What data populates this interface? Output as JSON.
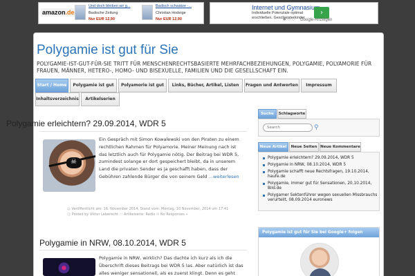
{
  "ads": {
    "amazon": {
      "logo": "amazon",
      "logo_suffix": ".de",
      "items": [
        {
          "title": "Und doch bleiben wir g...",
          "subtitle": "Badische Zeitung",
          "price": "Nur EUR 12,90"
        },
        {
          "title": "Badisch schwätze -...",
          "subtitle": "Christian Hodeige",
          "price": "Nur EUR 12,90"
        }
      ]
    },
    "google": {
      "title": "Internet und Gymnasium",
      "text": "Individuelle Potenziale optimal erschließen. Geschwisterkinder",
      "label": "Google-Anzeigen",
      "arrow": "›"
    }
  },
  "site": {
    "title": "Polygamie ist gut für Sie",
    "description": "POLYGAMIE-IST-GUT-FÜR-SIE TRITT FÜR MENSCHENRECHTSBASIERTE MEHRFACHBEZIEHUNGEN, POLYGAMIE, POLYAMORIE FÜR FRAUEN, MÄNNER, HETERO-, HOMO- UND BISEXUELLE, FAMILIEN UND DIE GESELLSCHAFT EIN."
  },
  "nav": {
    "items": [
      {
        "label": "Start / Home",
        "active": true
      },
      {
        "label": "Polygamie ist gut",
        "active": false
      },
      {
        "label": "Polyamorie ist gut",
        "active": false
      },
      {
        "label": "Links, Bücher, Artikel, Listen",
        "active": false
      },
      {
        "label": "Fragen und Antworten",
        "active": false
      },
      {
        "label": "Impressum",
        "active": false
      },
      {
        "label": "Inhaltsverzeichnis",
        "active": false
      },
      {
        "label": "Artikelserien",
        "active": false
      }
    ]
  },
  "posts": [
    {
      "title": "Polygamie erleichtern? 29.09.2014, WDR 5",
      "text": "Ein Gespräch mit Simon Kowalewski von den Piraten zu einem rechtlichen Rahmen für Polyamorie. Meiner Meinung nach ist das letztlich auch für Polygamie nötig. Der Beitrag bei WDR 5, zumindest solange er dort gespeichert bleibt, da in unserem Land die privaten Sender es ja geschafft haben, dass der Gebühren zahlende Bürger die von seinem Geld",
      "more": "…weiterlesen",
      "meta_published": "Veröffentlicht am: 16. November 2014, Stand vom: Montag, 10 November, 2014 um 17:41",
      "meta_author": "Posted by Viktor Leberecht",
      "meta_category": "Artikelserie: Radio",
      "meta_comments": "No Responses »"
    },
    {
      "title": "Polygamie in NRW, 08.10.2014, WDR 5",
      "text": "Polygamie in NRW, wirklich? Das dachte ich kurz als ich die Überschrift dieses Beitrags bei WDR 5 las. Aber natürlich ist das alles weniger sensationell, als es zuerst klingt. Denn es geht hier"
    }
  ],
  "sidebar": {
    "search_tabs": [
      {
        "label": "Suche",
        "active": true
      },
      {
        "label": "Schlagworte",
        "active": false
      }
    ],
    "search_placeholder": "Search",
    "article_tabs": [
      {
        "label": "Neue Artikel",
        "active": true
      },
      {
        "label": "Neue Seiten",
        "active": false
      },
      {
        "label": "Neue Kommentare",
        "active": false
      }
    ],
    "recent_articles": [
      "Polygamie erleichtern? 29.09.2014, WDR 5",
      "Polygamie in NRW, 08.10.2014, WDR 5",
      "Polygamie schafft neue Rechtsfragen, 19.10.2014, haufe.de",
      "Polygamie, immer gut für Sensationen, 20.10.2014, Bild.de",
      "Polygamer Sektenführer wegen sexuellen Missbrauchs verurteilt, 08.09.2014 euronews"
    ],
    "gplus_title": "Polygamie ist gut für Sie bei Google+ folgen"
  },
  "colors": {
    "accent": "#2a73b8",
    "tab_active": "#6fa3da",
    "background": "#3d3d3d"
  },
  "icons": {
    "search": "search-icon",
    "pirate": "skull-icon",
    "arrow": "arrow-right-icon"
  }
}
